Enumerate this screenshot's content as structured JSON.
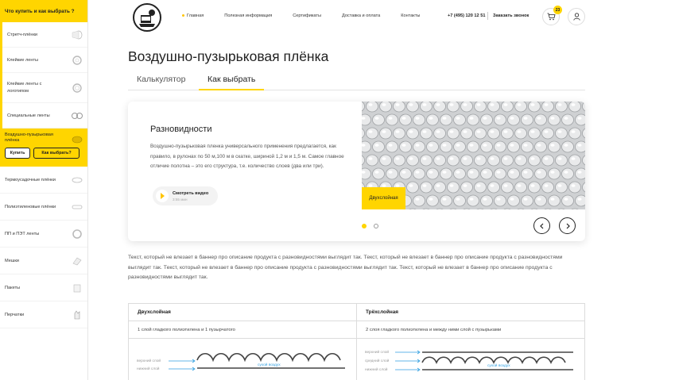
{
  "sidebar": {
    "header": "Что купить и как выбрать ?",
    "items_top": [
      {
        "label": "Стретч-плёнки",
        "icon": "film-roll-icon"
      },
      {
        "label": "Клейкие ленты",
        "icon": "tape-roll-icon"
      },
      {
        "label": "Клейкие ленты с логотипом",
        "icon": "logo-tape-icon"
      },
      {
        "label": "Специальные ленты",
        "icon": "special-tape-icon"
      }
    ],
    "active": {
      "label": "Воздушно-пузырьковая плёнка",
      "buy_button": "Купить",
      "how_button": "Как выбрать?"
    },
    "items_bottom": [
      {
        "label": "Термоусадочные плёнки",
        "icon": "shrink-film-icon"
      },
      {
        "label": "Полиэтиленовые плёнки",
        "icon": "pe-film-icon"
      },
      {
        "label": "ПП и ПЭТ ленты",
        "icon": "pp-tape-icon"
      },
      {
        "label": "Мешки",
        "icon": "bag-icon"
      },
      {
        "label": "Пакеты",
        "icon": "packet-icon"
      },
      {
        "label": "Перчатки",
        "icon": "glove-icon"
      }
    ]
  },
  "header": {
    "nav": [
      "Главная",
      "Полезная информация",
      "Сертификаты",
      "Доставка и оплата",
      "Контакты"
    ],
    "phone": "+7 (495) 120 12 51",
    "callback": "Заказать звонок",
    "cart_count": "23"
  },
  "main": {
    "title": "Воздушно-пузырьковая плёнка",
    "tabs": [
      "Калькулятор",
      "Как выбрать"
    ],
    "banner": {
      "title": "Разновидности",
      "text": "Воздушно-пузырьковая пленка универсального применения предлагается, как правило, в рулонах по 50 м,100 м в скатке, шириной 1,2 м и 1,5 м. Самое главное отличие полотна – это его структура, т.е. количество слоев (два или три).",
      "video_label": "Смотреть видео",
      "video_time": "3:55 мин",
      "badge": "Двухслойная"
    },
    "description": "Текст, который не влезает в баннер про описание продукта с разновидностями выглядит так. Текст, который не влезает в баннер про описание продукта с разновидностями выглядит так. Текст, который не влезает в баннер про описание продукта с разновидностями выглядит так. Текст, который не влезает в баннер про описание продукта с разновидностями выглядит так.",
    "table": {
      "col1_title": "Двухслойная",
      "col1_desc": "1 слой гладкого полиэтилена и 1 пузырчатого",
      "col2_title": "Трёхслойная",
      "col2_desc": "2 слоя гладкого полиэтилена и между ними слой с  пузырьками",
      "diag1": {
        "top": "верхний слой",
        "bottom": "нижний слой",
        "air": "сухой воздух"
      },
      "diag2": {
        "top": "верхний слой",
        "middle": "средний слой",
        "bottom": "нижний слой",
        "air": "сухой воздух"
      }
    }
  },
  "colors": {
    "accent": "#ffd500",
    "arrow": "#2f9ee0"
  }
}
